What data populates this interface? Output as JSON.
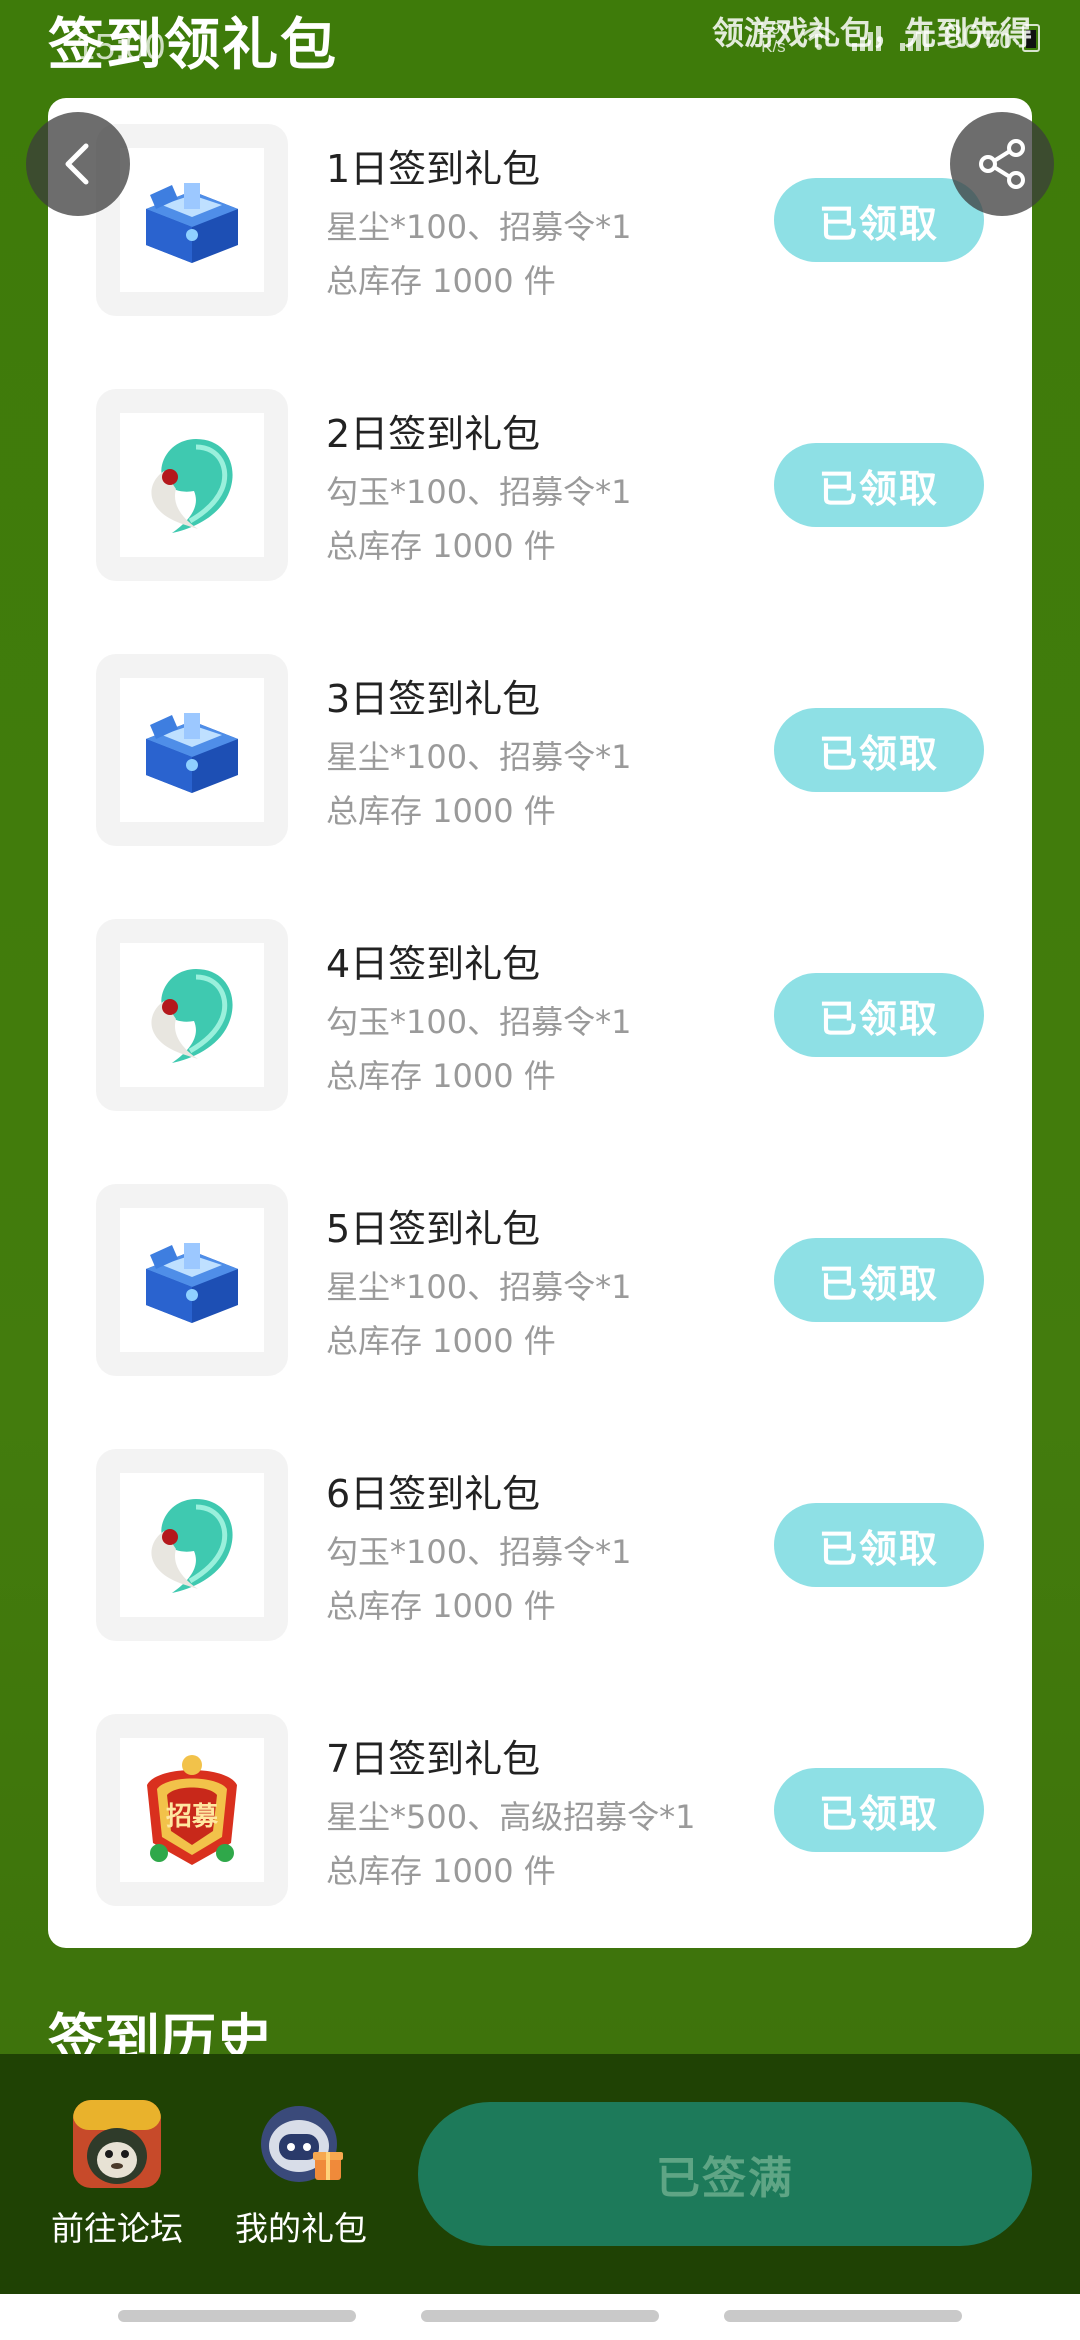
{
  "status_bar": {
    "time": "15:00",
    "net_speed_value": "1.90",
    "net_speed_unit": "K/s",
    "battery_percent": "80%"
  },
  "header": {
    "title": "签到领礼包",
    "slogan": "领游戏礼包，先到先得"
  },
  "gifts": [
    {
      "name": "1日签到礼包",
      "content": "星尘*100、招募令*1",
      "stock": "总库存 1000 件",
      "button": "已领取",
      "icon": "star-dust-chest-icon"
    },
    {
      "name": "2日签到礼包",
      "content": "勾玉*100、招募令*1",
      "stock": "总库存 1000 件",
      "button": "已领取",
      "icon": "magatama-icon"
    },
    {
      "name": "3日签到礼包",
      "content": "星尘*100、招募令*1",
      "stock": "总库存 1000 件",
      "button": "已领取",
      "icon": "star-dust-chest-icon"
    },
    {
      "name": "4日签到礼包",
      "content": "勾玉*100、招募令*1",
      "stock": "总库存 1000 件",
      "button": "已领取",
      "icon": "magatama-icon"
    },
    {
      "name": "5日签到礼包",
      "content": "星尘*100、招募令*1",
      "stock": "总库存 1000 件",
      "button": "已领取",
      "icon": "star-dust-chest-icon"
    },
    {
      "name": "6日签到礼包",
      "content": "勾玉*100、招募令*1",
      "stock": "总库存 1000 件",
      "button": "已领取",
      "icon": "magatama-icon"
    },
    {
      "name": "7日签到礼包",
      "content": "星尘*500、高级招募令*1",
      "stock": "总库存 1000 件",
      "button": "已领取",
      "icon": "advanced-recruit-badge-icon",
      "badge_text": "招募"
    }
  ],
  "history": {
    "title": "签到历史"
  },
  "bottom_bar": {
    "forum_label": "前往论坛",
    "my_gifts_label": "我的礼包",
    "signed_button": "已签满"
  },
  "colors": {
    "page_background": "#3f7a0c",
    "claim_button": "#8ee0e5",
    "signed_button": "#1d7a5a",
    "bottom_bar": "#1f4204"
  }
}
